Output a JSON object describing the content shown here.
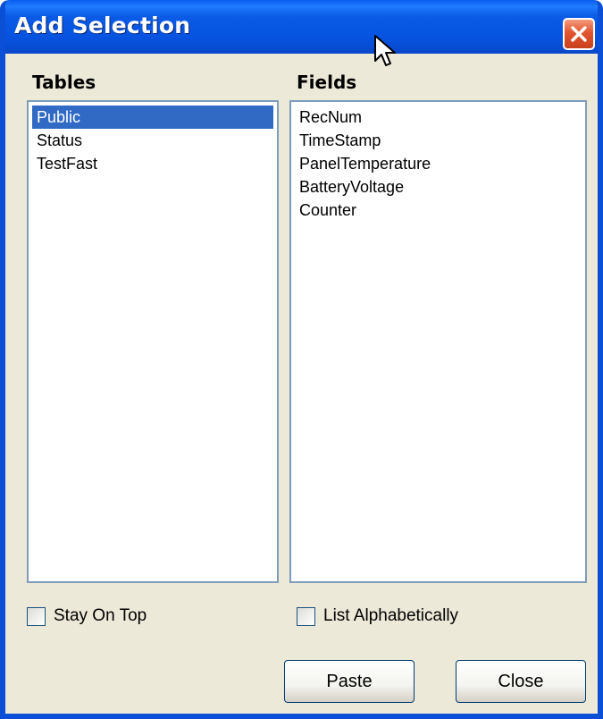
{
  "window": {
    "title": "Add Selection",
    "accent": "#0a4fd6",
    "close_icon": "close-icon"
  },
  "tables": {
    "header": "Tables",
    "items": [
      "Public",
      "Status",
      "TestFast"
    ],
    "selected": "Public"
  },
  "fields": {
    "header": "Fields",
    "items": [
      "RecNum",
      "TimeStamp",
      "PanelTemperature",
      "BatteryVoltage",
      "Counter"
    ]
  },
  "options": {
    "stay_on_top": {
      "label": "Stay On Top",
      "checked": false
    },
    "list_alphabetically": {
      "label": "List Alphabetically",
      "checked": false
    }
  },
  "buttons": {
    "paste": "Paste",
    "close": "Close"
  },
  "colors": {
    "selection_bg": "#316ac5",
    "dialog_bg": "#ece9d8"
  }
}
